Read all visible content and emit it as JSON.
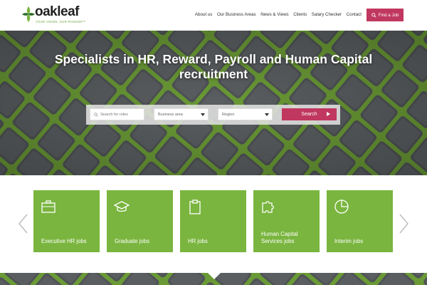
{
  "brand": {
    "name": "oakleaf",
    "tagline": "YOUR VISION, OUR PASSION™",
    "accent": "#c0375f",
    "green": "#7ab53f"
  },
  "nav": {
    "items": [
      "About us",
      "Our Business Areas",
      "News & Views",
      "Clients",
      "Salary Checker",
      "Contact"
    ],
    "cta_label": "Find a Job",
    "cta_icon": "search-icon"
  },
  "hero": {
    "title": "Specialists in HR, Reward, Payroll and Human Capital recruitment",
    "search": {
      "roles_placeholder": "Search for roles",
      "business_area_label": "Business area",
      "region_label": "Region",
      "button_label": "Search"
    }
  },
  "cards": [
    {
      "label": "Executive HR jobs",
      "icon": "briefcase-icon"
    },
    {
      "label": "Graduate jobs",
      "icon": "graduation-cap-icon"
    },
    {
      "label": "HR jobs",
      "icon": "clipboard-icon"
    },
    {
      "label": "Human Capital Services jobs",
      "icon": "puzzle-icon"
    },
    {
      "label": "Interim jobs",
      "icon": "pie-chart-icon"
    }
  ]
}
